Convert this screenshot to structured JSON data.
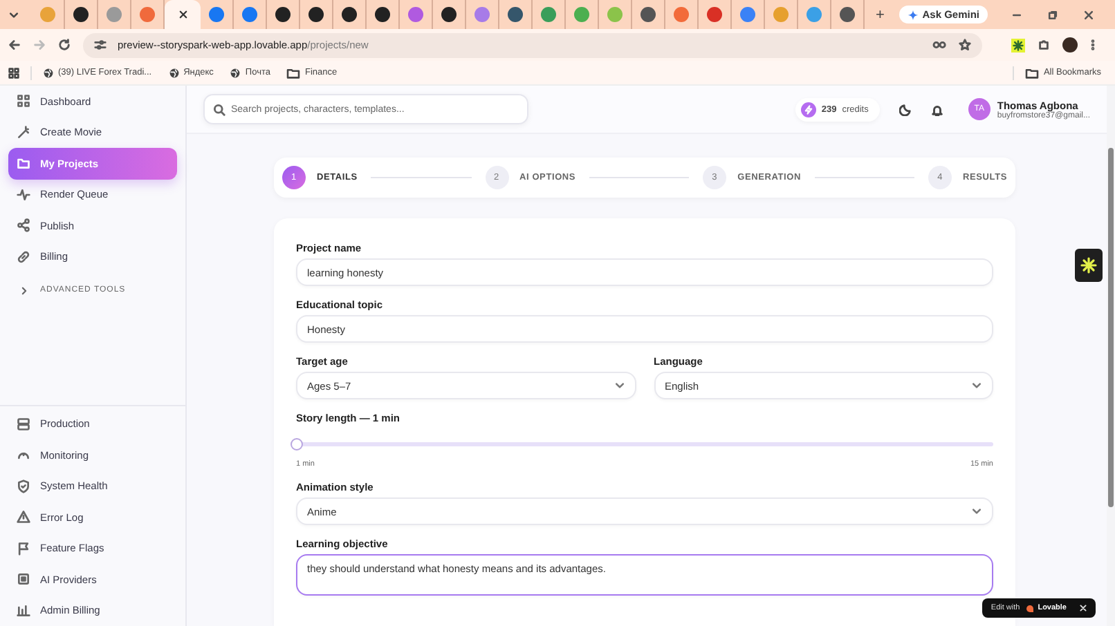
{
  "browser": {
    "tabs": [
      {
        "selected": false,
        "color": "#e8a33a"
      },
      {
        "selected": false,
        "color": "#222222"
      },
      {
        "selected": false,
        "color": "#9a9a9a"
      },
      {
        "selected": false,
        "color": "#f06a3c"
      },
      {
        "selected": true
      },
      {
        "selected": false,
        "color": "#1877f2"
      },
      {
        "selected": false,
        "color": "#1877f2"
      },
      {
        "selected": false,
        "color": "#222222"
      },
      {
        "selected": false,
        "color": "#222222"
      },
      {
        "selected": false,
        "color": "#222222"
      },
      {
        "selected": false,
        "color": "#222222"
      },
      {
        "selected": false,
        "color": "#b05ae0"
      },
      {
        "selected": false,
        "color": "#222222"
      },
      {
        "selected": false,
        "color": "#a77be8"
      },
      {
        "selected": false,
        "color": "#35566b"
      },
      {
        "selected": false,
        "color": "#3a9e5a"
      },
      {
        "selected": false,
        "color": "#4caf50"
      },
      {
        "selected": false,
        "color": "#8bc34a"
      },
      {
        "selected": false,
        "color": "#555555"
      },
      {
        "selected": false,
        "color": "#f26b3a"
      },
      {
        "selected": false,
        "color": "#d93025"
      },
      {
        "selected": false,
        "color": "#3b82f6"
      },
      {
        "selected": false,
        "color": "#e6a02e"
      },
      {
        "selected": false,
        "color": "#3ba0e6"
      },
      {
        "selected": false,
        "color": "#555555"
      }
    ],
    "new_tab": "+",
    "ask_gemini": "Ask Gemini",
    "url": {
      "host": "preview--storyspark-web-app.lovable.app",
      "path": "/projects/new"
    },
    "bookmarks": [
      {
        "label": "(39) LIVE Forex Tradi...",
        "kind": "globe"
      },
      {
        "label": "Яндекс",
        "kind": "globe"
      },
      {
        "label": "Почта",
        "kind": "globe"
      },
      {
        "label": "Finance",
        "kind": "folder"
      }
    ],
    "all_bookmarks": "All Bookmarks"
  },
  "sidebar": {
    "items": [
      {
        "label": "Dashboard",
        "selected": false
      },
      {
        "label": "Create Movie",
        "selected": false
      },
      {
        "label": "My Projects",
        "selected": true
      },
      {
        "label": "Render Queue",
        "selected": false
      },
      {
        "label": "Publish",
        "selected": false
      },
      {
        "label": "Billing",
        "selected": false
      }
    ],
    "section": {
      "label": "ADVANCED TOOLS",
      "expanded": false
    },
    "admin_items": [
      {
        "label": "Production",
        "selected": false
      },
      {
        "label": "Monitoring",
        "selected": false
      },
      {
        "label": "System Health",
        "selected": false
      },
      {
        "label": "Error Log",
        "selected": false
      },
      {
        "label": "Feature Flags",
        "selected": false
      },
      {
        "label": "AI Providers",
        "selected": false
      },
      {
        "label": "Admin Billing",
        "selected": false
      }
    ]
  },
  "header": {
    "search": {
      "placeholder": "Search projects, characters, templates..."
    },
    "credits": {
      "count": "239",
      "label": "credits"
    },
    "user": {
      "initials": "TA",
      "name": "Thomas Agbona",
      "email": "buyfromstore37@gmail..."
    }
  },
  "stepper": [
    {
      "number": "1",
      "label": "DETAILS",
      "selected": true
    },
    {
      "number": "2",
      "label": "AI OPTIONS",
      "selected": false
    },
    {
      "number": "3",
      "label": "GENERATION",
      "selected": false
    },
    {
      "number": "4",
      "label": "RESULTS",
      "selected": false
    }
  ],
  "form": {
    "rows": [
      [
        {
          "kind": "text",
          "label": "Project name",
          "value": "learning honesty",
          "focused": false
        }
      ],
      [
        {
          "kind": "text",
          "label": "Educational topic",
          "value": "Honesty",
          "focused": false
        }
      ],
      [
        {
          "kind": "select",
          "label": "Target age",
          "value": "Ages 5–7"
        },
        {
          "kind": "select",
          "label": "Language",
          "value": "English"
        }
      ],
      [
        {
          "kind": "slider",
          "label": "Story length — 1 min",
          "level": 0,
          "min_label": "1 min",
          "max_label": "15 min"
        }
      ],
      [
        {
          "kind": "select",
          "label": "Animation style",
          "value": "Anime"
        }
      ],
      [
        {
          "kind": "textarea",
          "label": "Learning objective",
          "value": "they should understand what honesty means and its advantages.",
          "focused": true
        }
      ]
    ]
  },
  "lovable_badge": {
    "label": "Edit with",
    "brand": "Lovable"
  }
}
